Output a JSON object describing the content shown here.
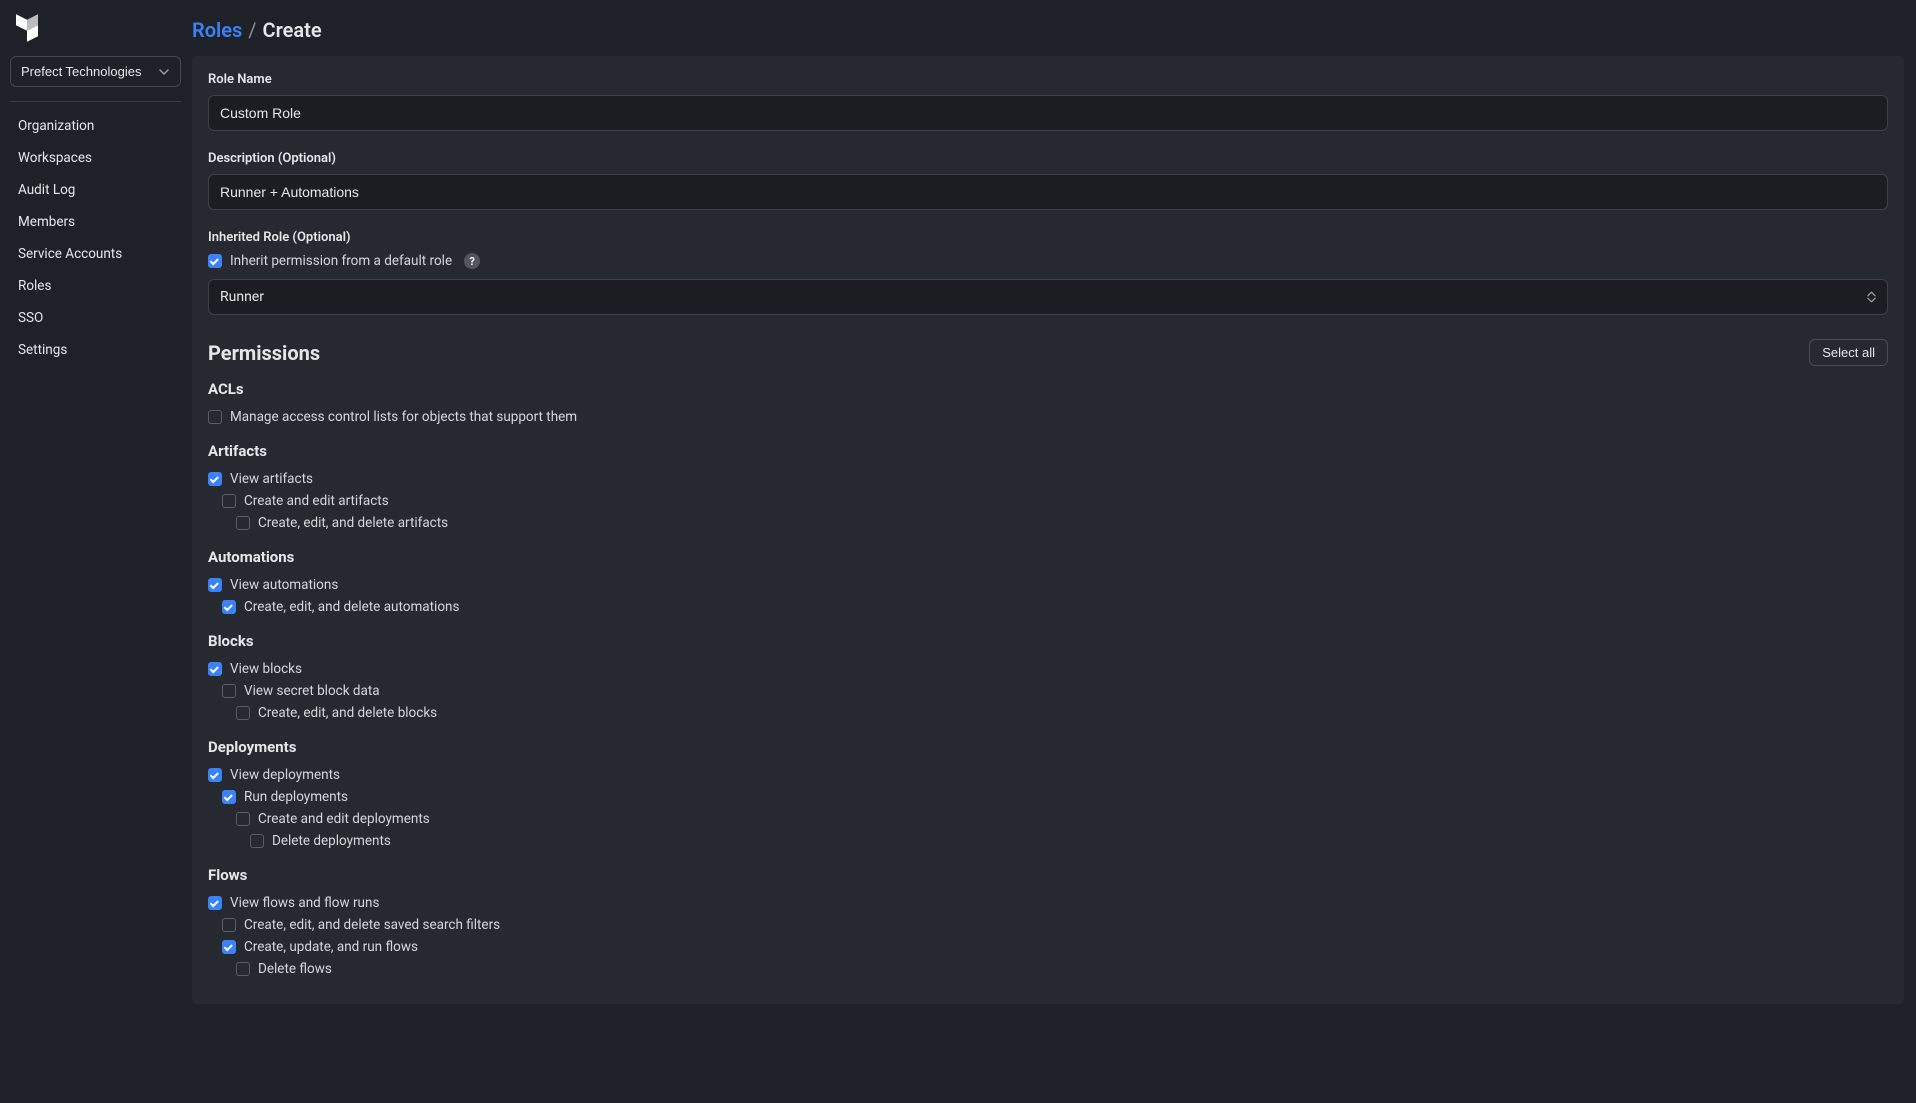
{
  "workspace": {
    "current": "Prefect Technologies"
  },
  "sidebar": {
    "nav": [
      "Organization",
      "Workspaces",
      "Audit Log",
      "Members",
      "Service Accounts",
      "Roles",
      "SSO",
      "Settings"
    ]
  },
  "breadcrumb": {
    "link_label": "Roles",
    "sep": "/",
    "current": "Create"
  },
  "form": {
    "name_label": "Role Name",
    "name_value": "Custom Role",
    "desc_label": "Description (Optional)",
    "desc_value": "Runner + Automations",
    "inherited_label": "Inherited Role (Optional)",
    "inherit_cb_label": "Inherit permission from a default role",
    "inherit_cb_checked": true,
    "inherited_select_value": "Runner",
    "help_glyph": "?"
  },
  "permissions": {
    "header": "Permissions",
    "select_all_label": "Select all",
    "groups": [
      {
        "title": "ACLs",
        "rows": [
          {
            "label": "Manage access control lists for objects that support them",
            "checked": false,
            "indent": 0
          }
        ]
      },
      {
        "title": "Artifacts",
        "rows": [
          {
            "label": "View artifacts",
            "checked": true,
            "indent": 0
          },
          {
            "label": "Create and edit artifacts",
            "checked": false,
            "indent": 1
          },
          {
            "label": "Create, edit, and delete artifacts",
            "checked": false,
            "indent": 2
          }
        ]
      },
      {
        "title": "Automations",
        "rows": [
          {
            "label": "View automations",
            "checked": true,
            "indent": 0
          },
          {
            "label": "Create, edit, and delete automations",
            "checked": true,
            "indent": 1
          }
        ]
      },
      {
        "title": "Blocks",
        "rows": [
          {
            "label": "View blocks",
            "checked": true,
            "indent": 0
          },
          {
            "label": "View secret block data",
            "checked": false,
            "indent": 1
          },
          {
            "label": "Create, edit, and delete blocks",
            "checked": false,
            "indent": 2
          }
        ]
      },
      {
        "title": "Deployments",
        "rows": [
          {
            "label": "View deployments",
            "checked": true,
            "indent": 0
          },
          {
            "label": "Run deployments",
            "checked": true,
            "indent": 1
          },
          {
            "label": "Create and edit deployments",
            "checked": false,
            "indent": 2
          },
          {
            "label": "Delete deployments",
            "checked": false,
            "indent": 3
          }
        ]
      },
      {
        "title": "Flows",
        "rows": [
          {
            "label": "View flows and flow runs",
            "checked": true,
            "indent": 0
          },
          {
            "label": "Create, edit, and delete saved search filters",
            "checked": false,
            "indent": 1
          },
          {
            "label": "Create, update, and run flows",
            "checked": true,
            "indent": 1
          },
          {
            "label": "Delete flows",
            "checked": false,
            "indent": 2
          }
        ]
      }
    ]
  }
}
